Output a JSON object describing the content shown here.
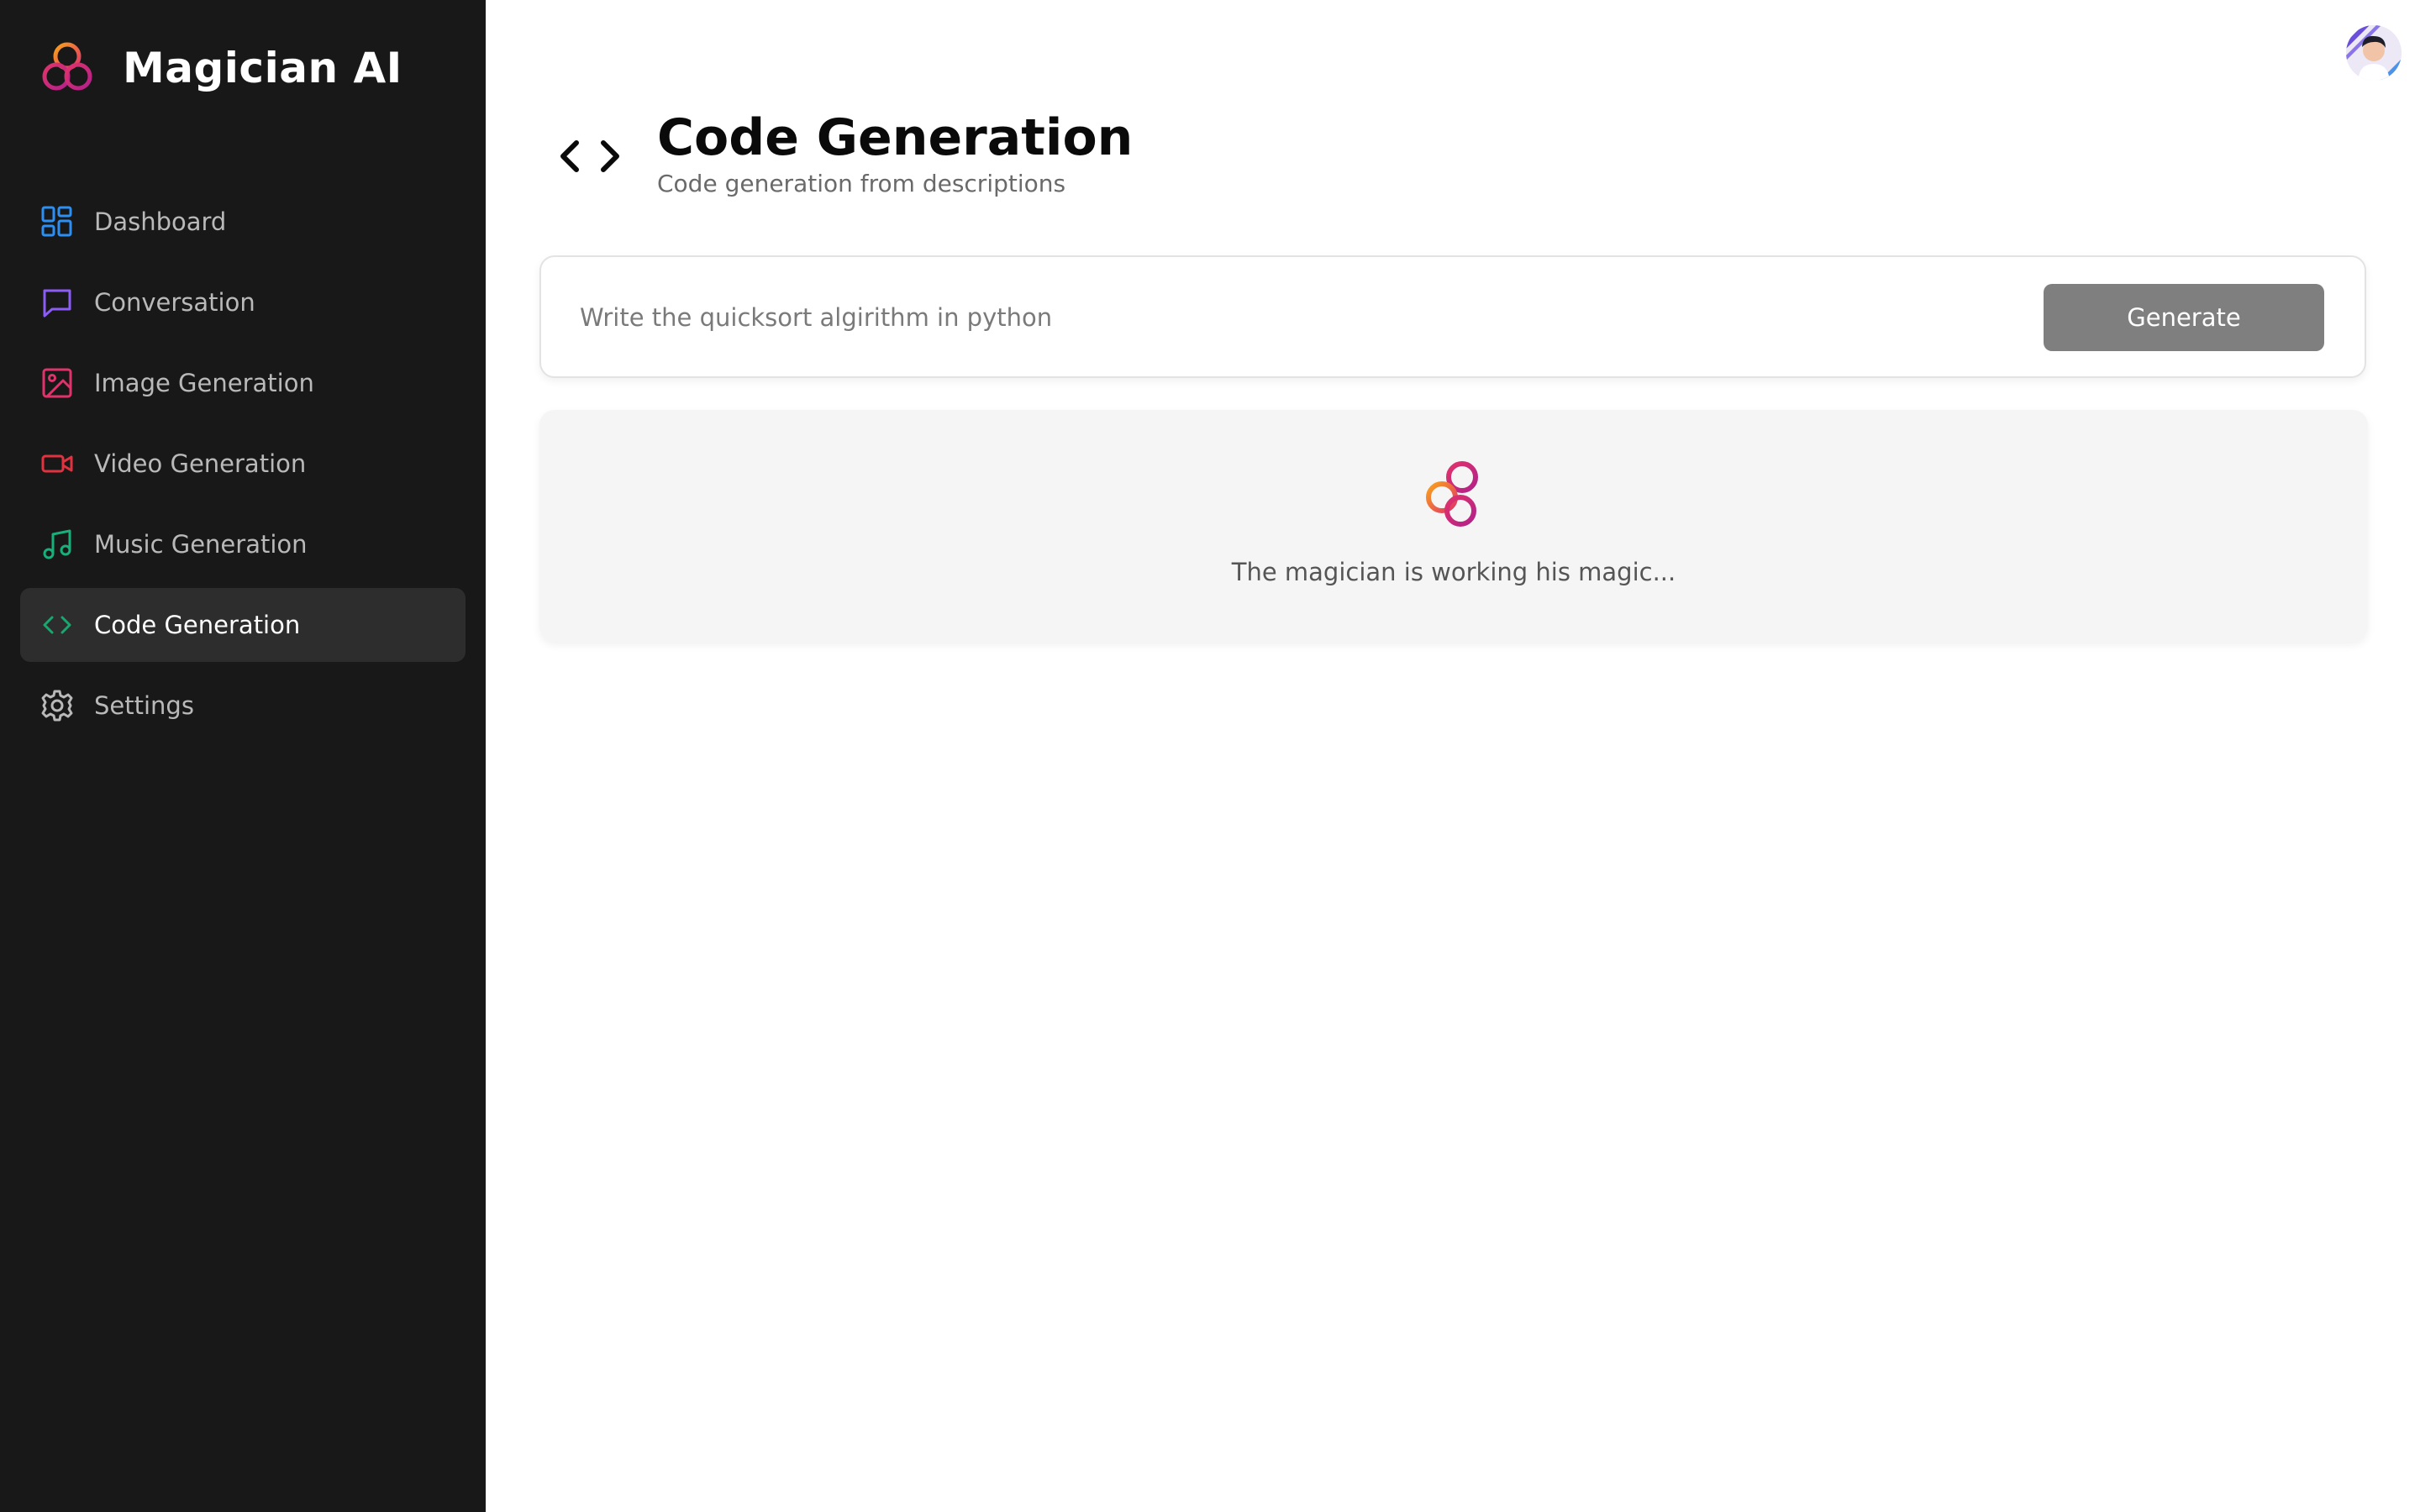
{
  "app": {
    "name": "Magician AI",
    "logo_icon": "magician-logo-icon"
  },
  "sidebar": {
    "items": [
      {
        "label": "Dashboard",
        "icon": "dashboard-grid-icon",
        "color": "#2d8ff2",
        "active": false
      },
      {
        "label": "Conversation",
        "icon": "message-square-icon",
        "color": "#8b5cf6",
        "active": false
      },
      {
        "label": "Image Generation",
        "icon": "image-icon",
        "color": "#e0336b",
        "active": false
      },
      {
        "label": "Video Generation",
        "icon": "video-camera-icon",
        "color": "#e0333f",
        "active": false
      },
      {
        "label": "Music Generation",
        "icon": "music-note-icon",
        "color": "#18b07a",
        "active": false
      },
      {
        "label": "Code Generation",
        "icon": "code-icon",
        "color": "#18a86f",
        "active": true
      },
      {
        "label": "Settings",
        "icon": "gear-icon",
        "color": "#b9b9b9",
        "active": false
      }
    ]
  },
  "header": {
    "icon": "code-icon",
    "title": "Code Generation",
    "subtitle": "Code generation from descriptions"
  },
  "prompt": {
    "value": "",
    "placeholder": "Write the quicksort algirithm in python",
    "button_label": "Generate"
  },
  "loading": {
    "icon": "magician-logo-icon",
    "message": "The magician is working his magic..."
  },
  "user": {
    "avatar_icon": "user-avatar"
  },
  "colors": {
    "sidebar_bg": "#181818",
    "active_item_bg": "#2d2d2d",
    "button_bg": "#7f7f7f",
    "loading_card_bg": "#f5f5f5",
    "logo_gradient_start": "#f9a21b",
    "logo_gradient_end": "#b2218a"
  }
}
